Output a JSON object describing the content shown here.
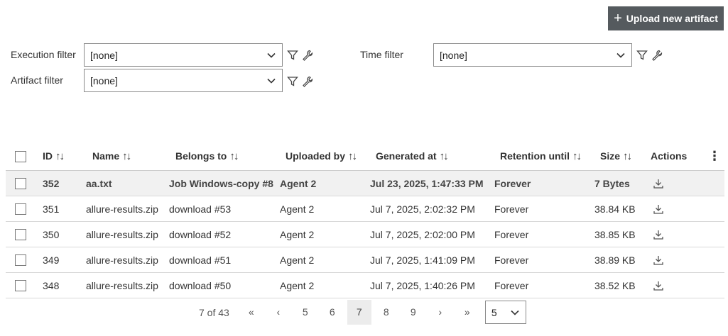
{
  "header": {
    "upload_label": "Upload new artifact"
  },
  "filters": {
    "execution": {
      "label": "Execution filter",
      "value": "[none]"
    },
    "time": {
      "label": "Time filter",
      "value": "[none]"
    },
    "artifact": {
      "label": "Artifact filter",
      "value": "[none]"
    }
  },
  "table": {
    "columns": {
      "id": "ID",
      "name": "Name",
      "belongs": "Belongs to",
      "uploaded": "Uploaded by",
      "generated": "Generated at",
      "retention": "Retention until",
      "size": "Size",
      "actions": "Actions"
    },
    "rows": [
      {
        "id": "352",
        "name": "aa.txt",
        "belongs": "Job Windows-copy #8",
        "uploaded": "Agent 2",
        "generated": "Jul 23, 2025, 1:47:33 PM",
        "retention": "Forever",
        "size": "7 Bytes"
      },
      {
        "id": "351",
        "name": "allure-results.zip",
        "belongs": "download #53",
        "uploaded": "Agent 2",
        "generated": "Jul 7, 2025, 2:02:32 PM",
        "retention": "Forever",
        "size": "38.84 KB"
      },
      {
        "id": "350",
        "name": "allure-results.zip",
        "belongs": "download #52",
        "uploaded": "Agent 2",
        "generated": "Jul 7, 2025, 2:02:00 PM",
        "retention": "Forever",
        "size": "38.85 KB"
      },
      {
        "id": "349",
        "name": "allure-results.zip",
        "belongs": "download #51",
        "uploaded": "Agent 2",
        "generated": "Jul 7, 2025, 1:41:09 PM",
        "retention": "Forever",
        "size": "38.89 KB"
      },
      {
        "id": "348",
        "name": "allure-results.zip",
        "belongs": "download #50",
        "uploaded": "Agent 2",
        "generated": "Jul 7, 2025, 1:40:26 PM",
        "retention": "Forever",
        "size": "38.52 KB"
      }
    ]
  },
  "pagination": {
    "info": "7 of 43",
    "first": "«",
    "prev": "‹",
    "pages": [
      "5",
      "6",
      "7",
      "8",
      "9"
    ],
    "current": "7",
    "next": "›",
    "last": "»",
    "page_size": "5"
  }
}
